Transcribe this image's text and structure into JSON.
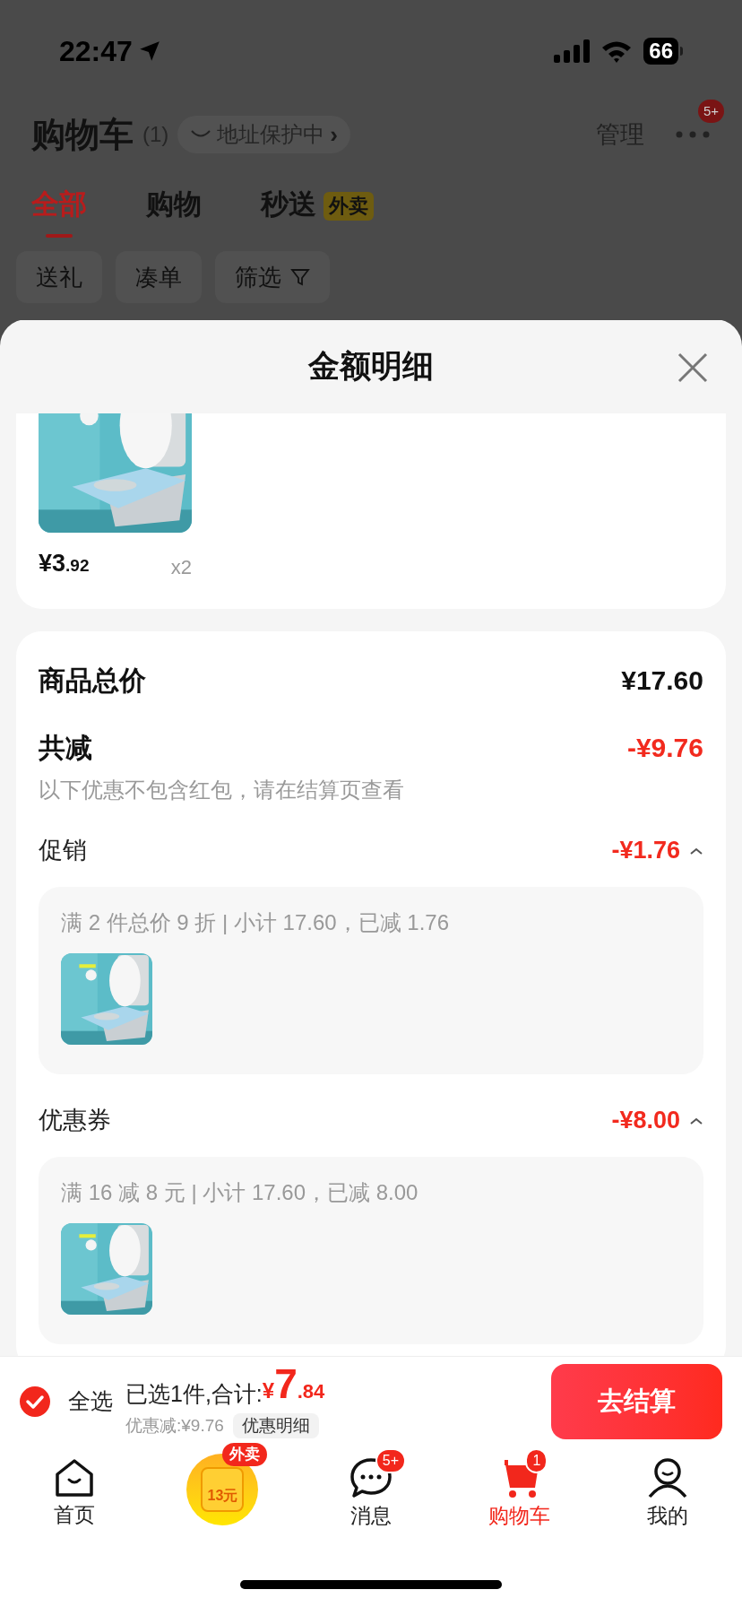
{
  "status_bar": {
    "time": "22:47",
    "battery": "66"
  },
  "header": {
    "title": "购物车",
    "count": "(1)",
    "address_badge": "地址保护中",
    "address_chevron": "›",
    "manage": "管理",
    "more_badge": "5+"
  },
  "tabs": [
    {
      "label": "全部",
      "selected": true
    },
    {
      "label": "购物",
      "selected": false
    },
    {
      "label": "秒送",
      "selected": false,
      "badge": "外卖"
    }
  ],
  "chips": [
    {
      "label": "送礼",
      "kind": "plain"
    },
    {
      "label": "凑单",
      "kind": "plain"
    },
    {
      "label": "筛选",
      "kind": "filter"
    }
  ],
  "sheet": {
    "title": "金额明细",
    "item": {
      "price_main": "¥3",
      "price_decimal": ".92",
      "quantity": "x2"
    },
    "summary": {
      "total_label": "商品总价",
      "total_value": "¥17.60",
      "discount_label": "共减",
      "discount_value": "-¥9.76",
      "note": "以下优惠不包含红包，请在结算页查看"
    },
    "sections": [
      {
        "label": "促销",
        "amount": "-¥1.76",
        "expanded": true,
        "detail": "满 2 件总价 9 折 | 小计 17.60，已减 1.76"
      },
      {
        "label": "优惠券",
        "amount": "-¥8.00",
        "expanded": true,
        "detail": "满 16 减 8 元 | 小计 17.60，已减 8.00"
      }
    ]
  },
  "checkout": {
    "select_all": {
      "label": "全选",
      "checked": true
    },
    "summary": "已选1件,合计:",
    "currency": "¥",
    "total_main": "7",
    "total_decimal": ".84",
    "saved": "优惠减:¥9.76",
    "details_button": "优惠明细",
    "checkout_button": "去结算"
  },
  "tab_bar": [
    {
      "kind": "home",
      "label": "首页",
      "selected": false
    },
    {
      "kind": "promo",
      "badge": "外卖",
      "promo_text": "13元",
      "selected": false
    },
    {
      "kind": "message",
      "label": "消息",
      "badge": "5+",
      "selected": false
    },
    {
      "kind": "cart",
      "label": "购物车",
      "badge": "1",
      "selected": true
    },
    {
      "kind": "me",
      "label": "我的",
      "selected": false
    }
  ]
}
